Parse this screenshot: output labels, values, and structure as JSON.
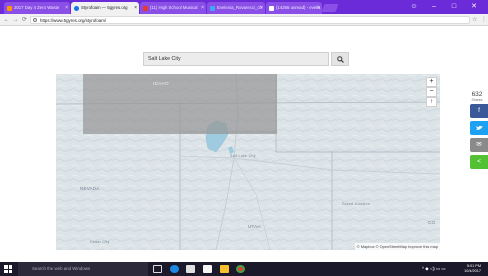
{
  "browser": {
    "tabs": [
      {
        "label": "2017 Day 4 Zero Waste",
        "favicon_color": "#ff9800"
      },
      {
        "label": "Styrofoam — 5gyres.org",
        "favicon_color": "#1a73e8",
        "active": true
      },
      {
        "label": "(11) High School Musical",
        "favicon_color": "#e53935"
      },
      {
        "label": "Evelenia_Rovarecci_ch",
        "favicon_color": "#42a5f5"
      },
      {
        "label": "(14266 unread) - evelia",
        "favicon_color": "#6b1fa5"
      }
    ],
    "url": "https://www.5gyres.org/styrofoam/",
    "window_controls": [
      "☺",
      "–",
      "□",
      "✕"
    ]
  },
  "search": {
    "value": "Salt Lake City",
    "button_icon": "search-icon"
  },
  "map": {
    "overlay_label": "IDAHO",
    "labels": {
      "nevada": "NEVADA",
      "utah": "UTAH",
      "salt_lake": "Salt Lake City",
      "co": "CO",
      "colorado_city": "Grand Junction",
      "south_city": "Cedar City"
    },
    "zoom_in": "+",
    "zoom_out": "−",
    "locate": "↑",
    "attribution": "© Mapbox © OpenStreetMap Improve this map"
  },
  "share": {
    "count": "632",
    "label": "Shares",
    "buttons": [
      {
        "name": "facebook",
        "glyph": "f",
        "color": "#3b5998"
      },
      {
        "name": "twitter",
        "glyph": "🐦",
        "color": "#1da1f2"
      },
      {
        "name": "email",
        "glyph": "✉",
        "color": "#8a8a8a"
      },
      {
        "name": "sharethis",
        "glyph": "<",
        "color": "#52c234"
      }
    ]
  },
  "taskbar": {
    "search_placeholder": "Search the web and Windows",
    "time": "5:01 PM",
    "date": "10/4/2017",
    "tray_text": "^ ◆ ◁) ▭ ▭"
  }
}
